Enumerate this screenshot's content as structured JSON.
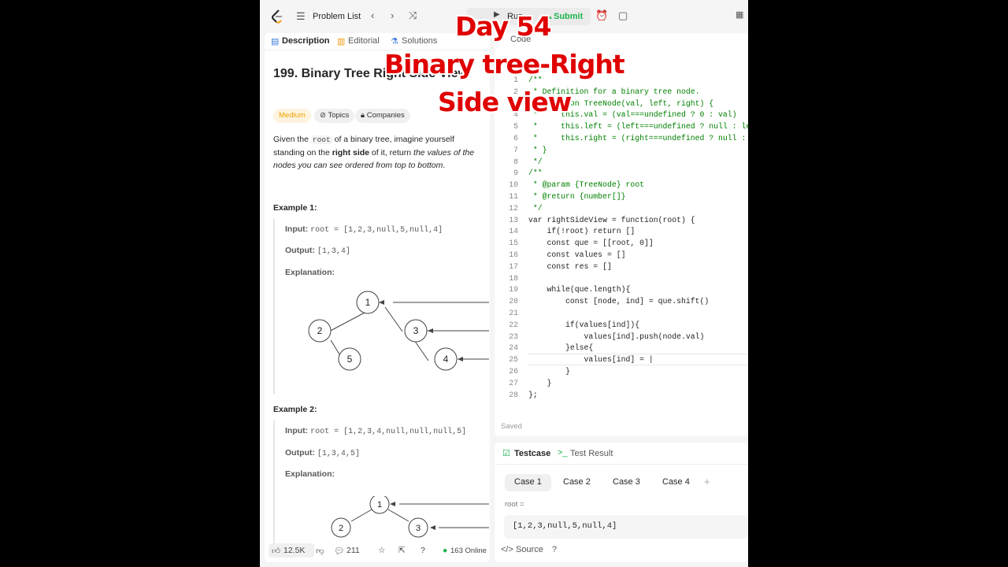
{
  "topbar": {
    "problem_list": "Problem List",
    "run": "Run",
    "submit": "Submit"
  },
  "left_tabs": {
    "description": "Description",
    "editorial": "Editorial",
    "solutions": "Solutions"
  },
  "problem": {
    "title": "199. Binary Tree Right Side View",
    "difficulty": "Medium",
    "topics": "Topics",
    "companies": "Companies",
    "desc_pre": "Given the ",
    "desc_code": "root",
    "desc_mid": " of a binary tree, imagine yourself standing on the ",
    "desc_bold": "right side",
    "desc_post": " of it, return ",
    "desc_italic": "the values of the nodes you can see ordered from top to bottom",
    "desc_end": "."
  },
  "examples": [
    {
      "heading": "Example 1:",
      "input_label": "Input:",
      "input": "root = [1,2,3,null,5,null,4]",
      "output_label": "Output:",
      "output": "[1,3,4]",
      "explanation_label": "Explanation:",
      "nodes": [
        "1",
        "2",
        "3",
        "5",
        "4"
      ]
    },
    {
      "heading": "Example 2:",
      "input_label": "Input:",
      "input": "root = [1,2,3,4,null,null,null,5]",
      "output_label": "Output:",
      "output": "[1,3,4,5]",
      "explanation_label": "Explanation:",
      "nodes": [
        "1",
        "2",
        "3"
      ]
    }
  ],
  "left_footer": {
    "likes": "12.5K",
    "comments": "211",
    "online": "163 Online"
  },
  "code_tab": "Code",
  "code_lines": [
    {
      "n": "1",
      "t": "/**"
    },
    {
      "n": "2",
      "t": " * Definition for a binary tree node."
    },
    {
      "n": "3",
      "t": " * function TreeNode(val, left, right) {"
    },
    {
      "n": "4",
      "t": " *     this.val = (val===undefined ? 0 : val)"
    },
    {
      "n": "5",
      "t": " *     this.left = (left===undefined ? null : left)"
    },
    {
      "n": "6",
      "t": " *     this.right = (right===undefined ? null : right)"
    },
    {
      "n": "7",
      "t": " * }"
    },
    {
      "n": "8",
      "t": " */"
    },
    {
      "n": "9",
      "t": "/**"
    },
    {
      "n": "10",
      "t": " * @param {TreeNode} root"
    },
    {
      "n": "11",
      "t": " * @return {number[]}"
    },
    {
      "n": "12",
      "t": " */"
    },
    {
      "n": "13",
      "t": "var rightSideView = function(root) {"
    },
    {
      "n": "14",
      "t": "    if(!root) return []"
    },
    {
      "n": "15",
      "t": "    const que = [[root, 0]]"
    },
    {
      "n": "16",
      "t": "    const values = []"
    },
    {
      "n": "17",
      "t": "    const res = []"
    },
    {
      "n": "18",
      "t": ""
    },
    {
      "n": "19",
      "t": "    while(que.length){"
    },
    {
      "n": "20",
      "t": "        const [node, ind] = que.shift()"
    },
    {
      "n": "21",
      "t": ""
    },
    {
      "n": "22",
      "t": "        if(values[ind]){"
    },
    {
      "n": "23",
      "t": "            values[ind].push(node.val)"
    },
    {
      "n": "24",
      "t": "        }else{"
    },
    {
      "n": "25",
      "t": "            values[ind] = |"
    },
    {
      "n": "26",
      "t": "        }"
    },
    {
      "n": "27",
      "t": "    }"
    },
    {
      "n": "28",
      "t": "};"
    }
  ],
  "code_status": "Saved",
  "testpanel": {
    "testcase": "Testcase",
    "test_result": "Test Result",
    "cases": [
      "Case 1",
      "Case 2",
      "Case 3",
      "Case 4"
    ],
    "root_label": "root =",
    "root_value": "[1,2,3,null,5,null,4]",
    "source": "Source"
  },
  "overlay": {
    "line1": "Day 54",
    "line2": "Binary tree-Right",
    "line3": "Side view"
  },
  "colors": {
    "accent_green": "#1eb44f",
    "overlay_red": "#e00000",
    "comment_green": "#008000",
    "keyword_blue": "#0000ff"
  }
}
